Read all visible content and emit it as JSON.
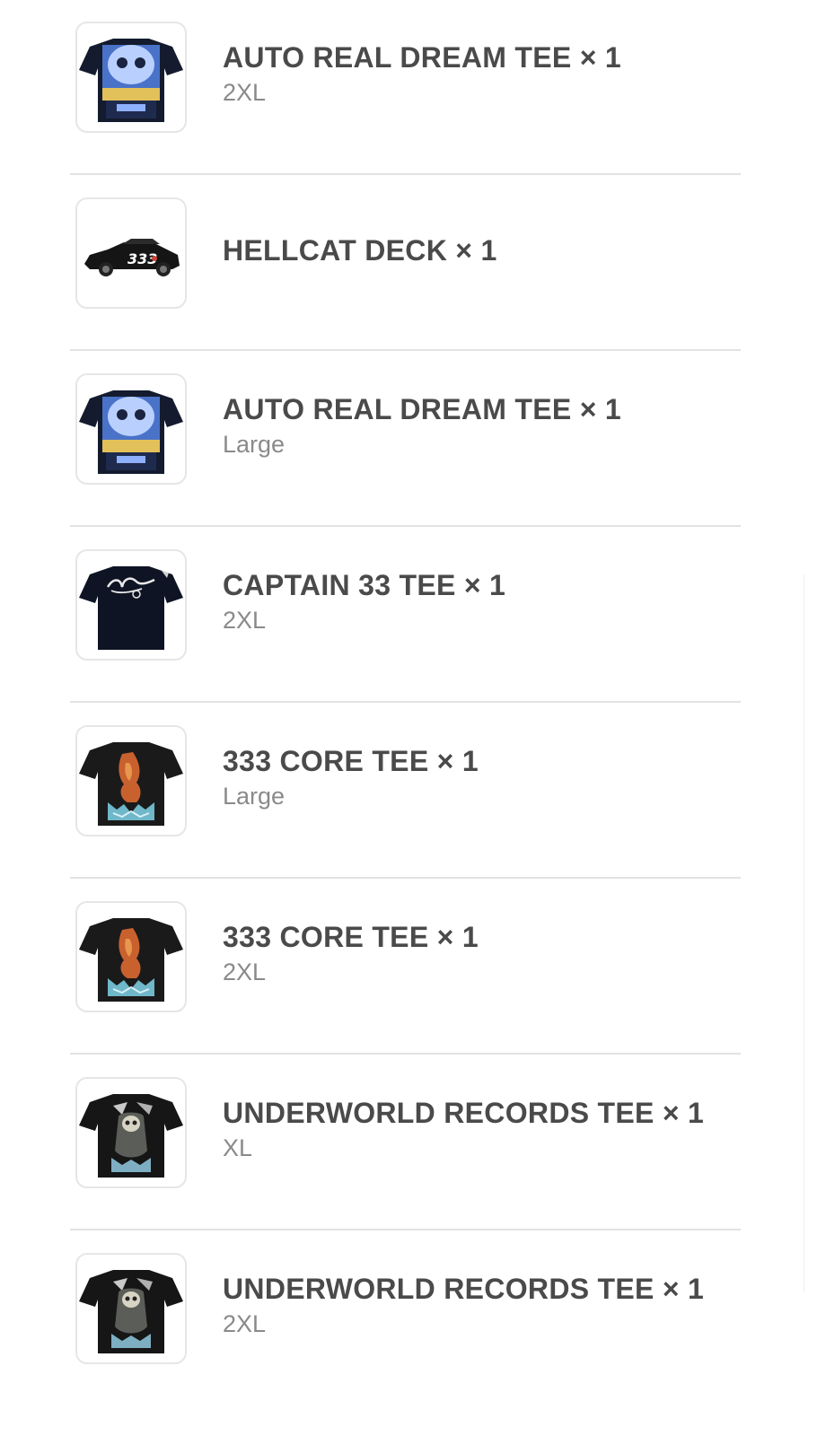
{
  "items": [
    {
      "title": "AUTO REAL DREAM TEE × 1",
      "variant": "2XL",
      "thumb": "tee-skull-print-icon"
    },
    {
      "title": "HELLCAT DECK × 1",
      "variant": "",
      "thumb": "race-car-deck-icon"
    },
    {
      "title": "AUTO REAL DREAM TEE × 1",
      "variant": "Large",
      "thumb": "tee-skull-print-icon"
    },
    {
      "title": "CAPTAIN 33 TEE × 1",
      "variant": "2XL",
      "thumb": "tee-script-logo-icon"
    },
    {
      "title": "333 CORE TEE × 1",
      "variant": "Large",
      "thumb": "tee-flame-print-icon"
    },
    {
      "title": "333 CORE TEE × 1",
      "variant": "2XL",
      "thumb": "tee-flame-print-icon"
    },
    {
      "title": "UNDERWORLD RECORDS TEE × 1",
      "variant": "XL",
      "thumb": "tee-grim-reaper-print-icon"
    },
    {
      "title": "UNDERWORLD RECORDS TEE × 1",
      "variant": "2XL",
      "thumb": "tee-grim-reaper-print-icon"
    }
  ],
  "deck_number": "333"
}
